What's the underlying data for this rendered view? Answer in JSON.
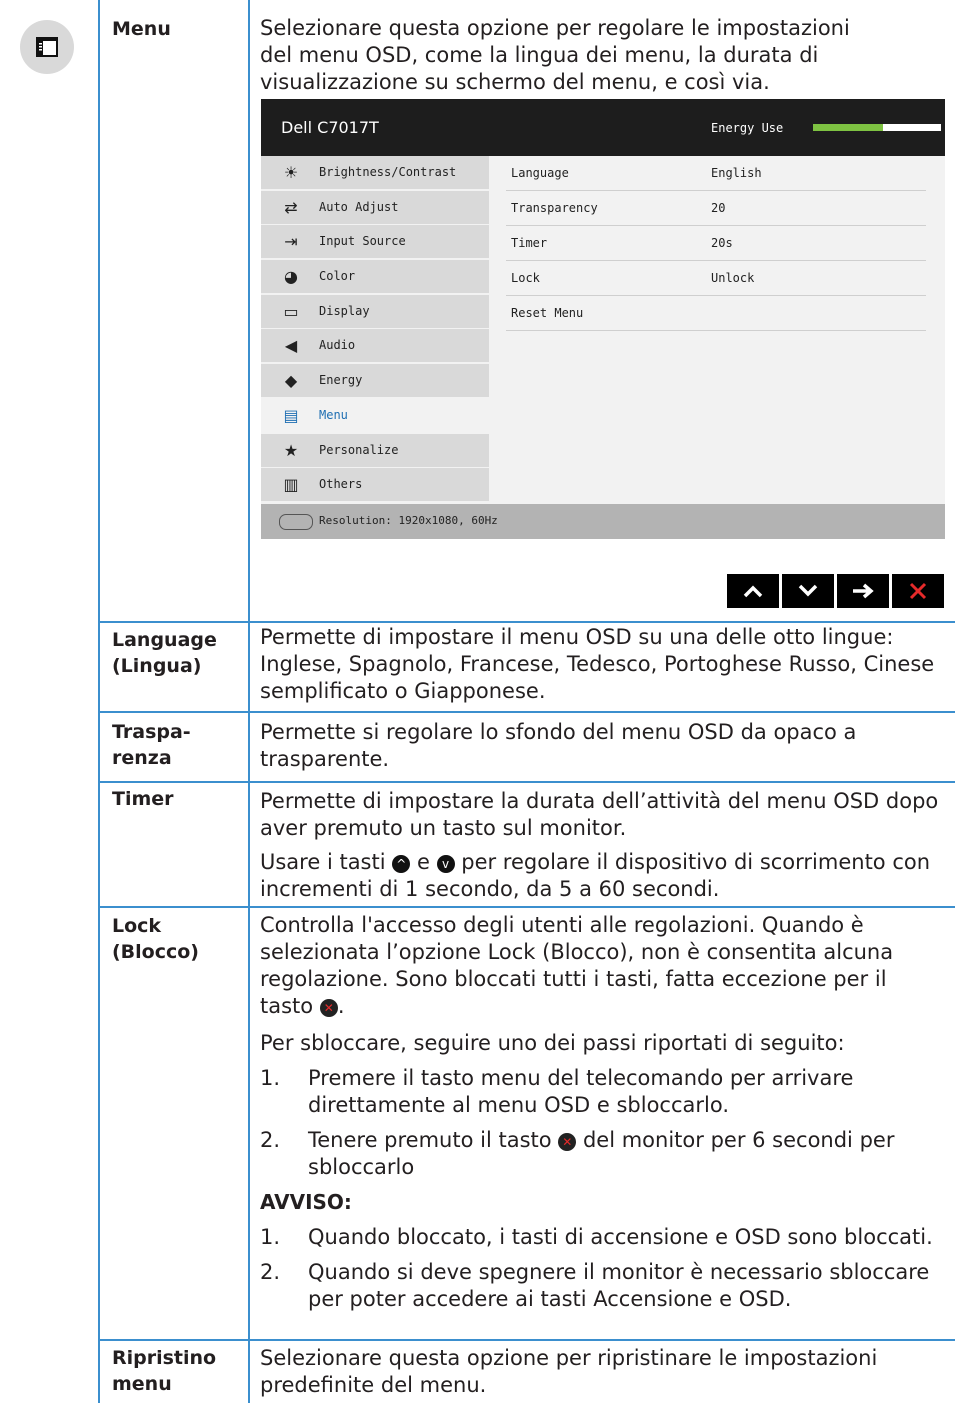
{
  "osd": {
    "model": "Dell C7017T",
    "energy_label": "Energy Use",
    "energy_level": 0.55,
    "menu_items": [
      {
        "label": "Brightness/Contrast",
        "icon": "brightness-icon"
      },
      {
        "label": "Auto Adjust",
        "icon": "auto-adjust-icon"
      },
      {
        "label": "Input Source",
        "icon": "input-source-icon"
      },
      {
        "label": "Color",
        "icon": "color-icon"
      },
      {
        "label": "Display",
        "icon": "display-icon"
      },
      {
        "label": "Audio",
        "icon": "audio-icon"
      },
      {
        "label": "Energy",
        "icon": "energy-icon"
      },
      {
        "label": "Menu",
        "icon": "menu-icon"
      },
      {
        "label": "Personalize",
        "icon": "star-icon"
      },
      {
        "label": "Others",
        "icon": "others-icon"
      }
    ],
    "active_item": "Menu",
    "settings": [
      {
        "key": "Language",
        "value": "English"
      },
      {
        "key": "Transparency",
        "value": "20"
      },
      {
        "key": "Timer",
        "value": "20s"
      },
      {
        "key": "Lock",
        "value": "Unlock"
      },
      {
        "key": "Reset Menu",
        "value": ""
      }
    ],
    "resolution": "Resolution: 1920x1080, 60Hz",
    "buttons": [
      "up",
      "down",
      "right",
      "close"
    ],
    "accent_color": "#1f6fb2",
    "energy_color": "#7ec242"
  },
  "rows": {
    "menu": {
      "label": "Menu",
      "text": "Selezionare questa opzione per regolare le impostazioni del menu OSD, come la lingua dei menu, la durata di visualizzazione su schermo del menu, e così via."
    },
    "language": {
      "label1": "Language",
      "label2": "(Lingua)",
      "text": "Permette di impostare il menu OSD su una delle otto lingue: Inglese, Spagnolo, Francese, Tedesco, Portoghese Russo, Cinese semplificato o Giapponese."
    },
    "transparency": {
      "label1": "Traspa-",
      "label2": "renza",
      "text": "Permette si regolare lo sfondo del menu OSD da opaco a trasparente."
    },
    "timer": {
      "label": "Timer",
      "text1": "Permette di impostare la durata dell’attività del menu OSD dopo aver premuto un tasto sul monitor.",
      "text2a": "Usare i tasti",
      "text2b": "e",
      "text2c": "per regolare il dispositivo di scorrimento con incrementi di 1 secondo, da 5 a 60 secondi."
    },
    "lock": {
      "label1": "Lock",
      "label2": "(Blocco)",
      "text1a": "Controlla l'accesso degli utenti alle regolazioni. Quando è selezionata l’opzione Lock (Blocco), non è consentita alcuna regolazione. Sono bloccati tutti i tasti, fatta eccezione per il tasto",
      "text1b": ".",
      "text2": "Per sbloccare, seguire uno dei passi riportati di seguito:",
      "step1": "Premere il tasto menu del telecomando per arrivare direttamente al menu OSD e sbloccarlo.",
      "step2a": "Tenere premuto il tasto",
      "step2b": "del monitor per 6 secondi per sbloccarlo",
      "notice_title": "AVVISO:",
      "notice1": "Quando bloccato, i tasti di accensione e OSD sono bloccati.",
      "notice2": "Quando si deve spegnere il monitor è necessario sbloccare per poter accedere ai tasti Accensione e OSD."
    },
    "reset": {
      "label1": "Ripristino",
      "label2": "menu",
      "text": "Selezionare questa opzione per ripristinare le impostazioni predefinite del menu."
    }
  },
  "numbers": {
    "one": "1.",
    "two": "2."
  }
}
